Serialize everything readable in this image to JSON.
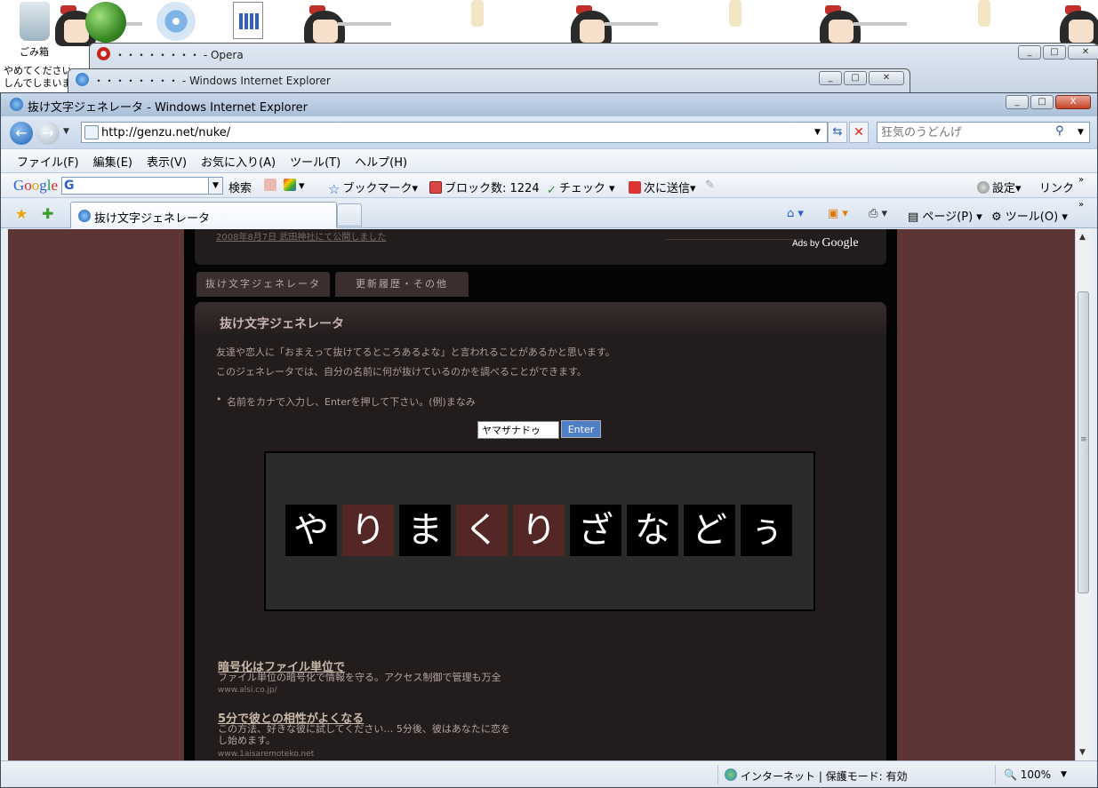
{
  "desktop": {
    "recycle_label": "ごみ箱",
    "side_text_line1": "やめてください",
    "side_text_line2": "しんでしまいま"
  },
  "bg_windows": {
    "opera_title": "・・・・・・・・ - Opera",
    "ie_back_title": "・・・・・・・・ - Windows Internet Explorer"
  },
  "window": {
    "title": "抜け文字ジェネレータ - Windows Internet Explorer",
    "caption_minimize": "_",
    "caption_maximize": "□",
    "caption_close": "X"
  },
  "address": {
    "url": "http://genzu.net/nuke/",
    "search_placeholder": "狂気のうどんげ"
  },
  "menu": [
    "ファイル(F)",
    "編集(E)",
    "表示(V)",
    "お気に入り(A)",
    "ツール(T)",
    "ヘルプ(H)"
  ],
  "google_toolbar": {
    "logo": [
      "G",
      "o",
      "o",
      "g",
      "l",
      "e"
    ],
    "search_label": "検索",
    "bookmarks_label": "ブックマーク▾",
    "block_label": "ブロック数: 1224",
    "check_label": "チェック",
    "send_label": "次に送信▾",
    "settings_label": "設定▾",
    "links_label": "リンク"
  },
  "tabs": {
    "active_label": "抜け文字ジェネレータ",
    "page_menu": "ページ(P)",
    "tools_menu": "ツール(O)"
  },
  "page": {
    "header_small": "2008年8月7日 武田神社にて公開しました",
    "ads_by": "Ads by",
    "ads_google": "Google",
    "nav_tabs": [
      "抜け文字ジェネレータ",
      "更新履歴・その他"
    ],
    "panel_title": "抜け文字ジェネレータ",
    "intro_1": "友達や恋人に「おまえって抜けてるところあるよな」と言われることがあるかと思います。",
    "intro_2": "このジェネレータでは、自分の名前に何が抜けているのかを調べることができます。",
    "bullet": "名前をカナで入力し、Enterを押して下さい。(例)まなみ",
    "name_value": "ヤマザナドゥ",
    "enter_label": "Enter",
    "result_tiles": [
      {
        "char": "や",
        "highlight": false
      },
      {
        "char": "り",
        "highlight": true
      },
      {
        "char": "ま",
        "highlight": false
      },
      {
        "char": "く",
        "highlight": true
      },
      {
        "char": "り",
        "highlight": true
      },
      {
        "char": "ざ",
        "highlight": false
      },
      {
        "char": "な",
        "highlight": false
      },
      {
        "char": "ど",
        "highlight": false
      },
      {
        "char": "ぅ",
        "highlight": false
      }
    ],
    "ads": [
      {
        "title": "暗号化はファイル単位で",
        "desc": [
          "ファイル単位の暗号化で情報を守る。アクセス制御で管理も万全"
        ],
        "url": "www.alsi.co.jp/"
      },
      {
        "title": "5分で彼との相性がよくなる",
        "desc": [
          "この方法、好きな彼に試してください… 5分後、彼はあなたに恋を",
          "し始めます。"
        ],
        "url": "www.1aisaremoteko.net"
      }
    ]
  },
  "status": {
    "zone": "インターネット | 保護モード: 有効",
    "zoom": "100%"
  },
  "colors": {
    "highlight_tile": "#552626",
    "normal_tile": "#000000",
    "page_bg": "#5e3535"
  }
}
